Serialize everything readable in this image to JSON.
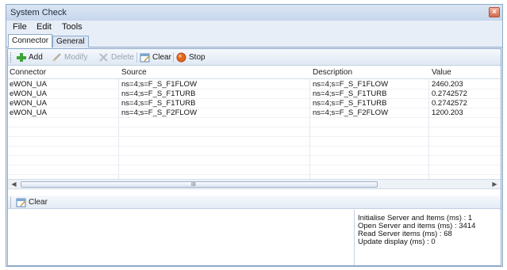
{
  "window": {
    "title": "System Check"
  },
  "menu": [
    "File",
    "Edit",
    "Tools"
  ],
  "tabs": [
    "Connector",
    "General"
  ],
  "toolbar": {
    "add": "Add",
    "modify": "Modify",
    "delete": "Delete",
    "clear": "Clear",
    "stop": "Stop"
  },
  "table": {
    "columns": [
      "Connector",
      "Source",
      "Description",
      "Value"
    ],
    "rows": [
      [
        "eWON_UA",
        "ns=4;s=F_S_F1FLOW",
        "ns=4;s=F_S_F1FLOW",
        "2460.203"
      ],
      [
        "eWON_UA",
        "ns=4;s=F_S_F1TURB",
        "ns=4;s=F_S_F1TURB",
        "0.2742572"
      ],
      [
        "eWON_UA",
        "ns=4;s=F_S_F1TURB",
        "ns=4;s=F_S_F1TURB",
        "0.2742572"
      ],
      [
        "eWON_UA",
        "ns=4;s=F_S_F2FLOW",
        "ns=4;s=F_S_F2FLOW",
        "1200.203"
      ]
    ]
  },
  "log_toolbar": {
    "clear": "Clear"
  },
  "log": [
    "Initialise Server and Items (ms) : 1",
    "Open Server and items (ms) : 3414",
    "Read Server items (ms) : 68",
    "Update display (ms) : 0"
  ],
  "scrollbar": {
    "thumb_glyph": "III"
  }
}
